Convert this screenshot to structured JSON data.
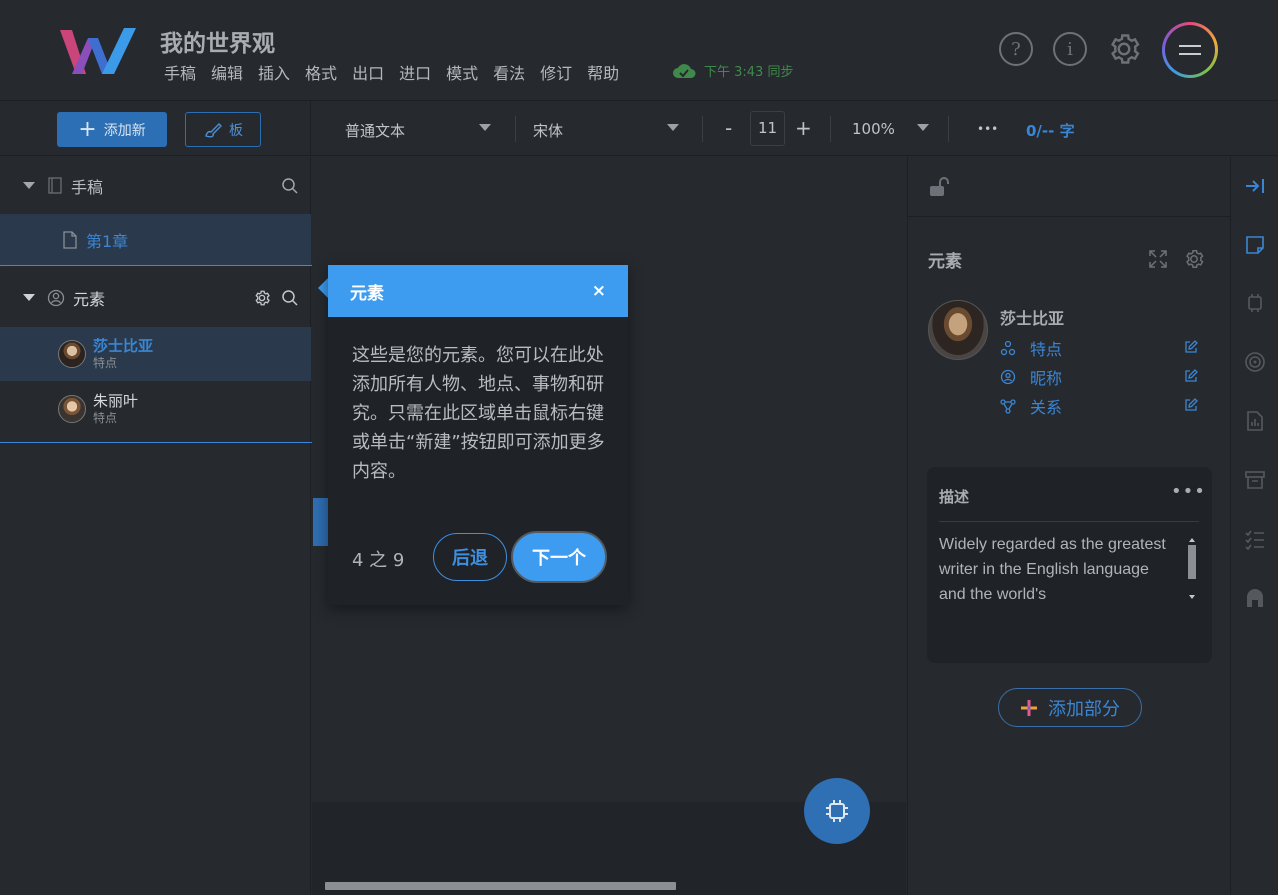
{
  "app": {
    "title": "我的世界观"
  },
  "menu": [
    "手稿",
    "编辑",
    "插入",
    "格式",
    "出口",
    "进口",
    "模式",
    "看法",
    "修订",
    "帮助"
  ],
  "sync": {
    "text": "下午 3:43 同步",
    "color": "#3f8a4a"
  },
  "header_icons": [
    "help-icon",
    "info-icon",
    "gear-icon",
    "menu-icon"
  ],
  "toolbar": {
    "add_new": "添加新",
    "board": "板",
    "style": "普通文本",
    "font": "宋体",
    "size_minus": "-",
    "size": "11",
    "size_plus": "+",
    "zoom": "100%",
    "more": "•••",
    "word_count": "0/-- 字"
  },
  "sidebar": {
    "manuscript": {
      "label": "手稿",
      "chapters": [
        {
          "label": "第1章"
        }
      ]
    },
    "elements": {
      "label": "元素",
      "items": [
        {
          "name": "莎士比亚",
          "sub": "特点",
          "selected": true
        },
        {
          "name": "朱丽叶",
          "sub": "特点",
          "selected": false
        }
      ]
    }
  },
  "tour": {
    "title": "元素",
    "close": "×",
    "body": "这些是您的元素。您可以在此处添加所有人物、地点、事物和研究。只需在此区域单击鼠标右键或单击“新建”按钮即可添加更多内容。",
    "count": "4 之 9",
    "back": "后退",
    "next": "下一个"
  },
  "panel": {
    "title": "元素",
    "element_name": "莎士比亚",
    "attributes": [
      {
        "label": "特点",
        "icon": "traits-icon"
      },
      {
        "label": "昵称",
        "icon": "nickname-icon"
      },
      {
        "label": "关系",
        "icon": "relations-icon"
      }
    ],
    "description": {
      "title": "描述",
      "more": "•••",
      "text": "Widely regarded as the greatest writer in the English language and the world's"
    },
    "add_section": "添加部分"
  },
  "colors": {
    "accent": "#3d9cf0",
    "link": "#3a86d4",
    "background": "#262a2f"
  }
}
